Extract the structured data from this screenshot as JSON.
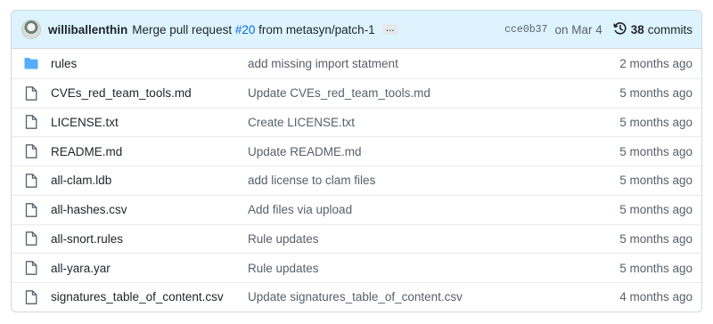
{
  "header": {
    "author": "williballenthin",
    "message_prefix": "Merge pull request",
    "pr_link": "#20",
    "message_suffix": "from metasyn/patch-1",
    "ellipsis": "…",
    "sha": "cce0b37",
    "date": "on Mar 4",
    "commit_count": "38",
    "commits_label": "commits"
  },
  "files": [
    {
      "type": "folder",
      "name": "rules",
      "message": "add missing import statment",
      "age": "2 months ago"
    },
    {
      "type": "file",
      "name": "CVEs_red_team_tools.md",
      "message": "Update CVEs_red_team_tools.md",
      "age": "5 months ago"
    },
    {
      "type": "file",
      "name": "LICENSE.txt",
      "message": "Create LICENSE.txt",
      "age": "5 months ago"
    },
    {
      "type": "file",
      "name": "README.md",
      "message": "Update README.md",
      "age": "5 months ago"
    },
    {
      "type": "file",
      "name": "all-clam.ldb",
      "message": "add license to clam files",
      "age": "5 months ago"
    },
    {
      "type": "file",
      "name": "all-hashes.csv",
      "message": "Add files via upload",
      "age": "5 months ago"
    },
    {
      "type": "file",
      "name": "all-snort.rules",
      "message": "Rule updates",
      "age": "5 months ago"
    },
    {
      "type": "file",
      "name": "all-yara.yar",
      "message": "Rule updates",
      "age": "5 months ago"
    },
    {
      "type": "file",
      "name": "signatures_table_of_content.csv",
      "message": "Update signatures_table_of_content.csv",
      "age": "4 months ago"
    }
  ],
  "colors": {
    "folder": "#54aeff",
    "link": "#0969da",
    "header_bg": "#ddf4ff"
  }
}
